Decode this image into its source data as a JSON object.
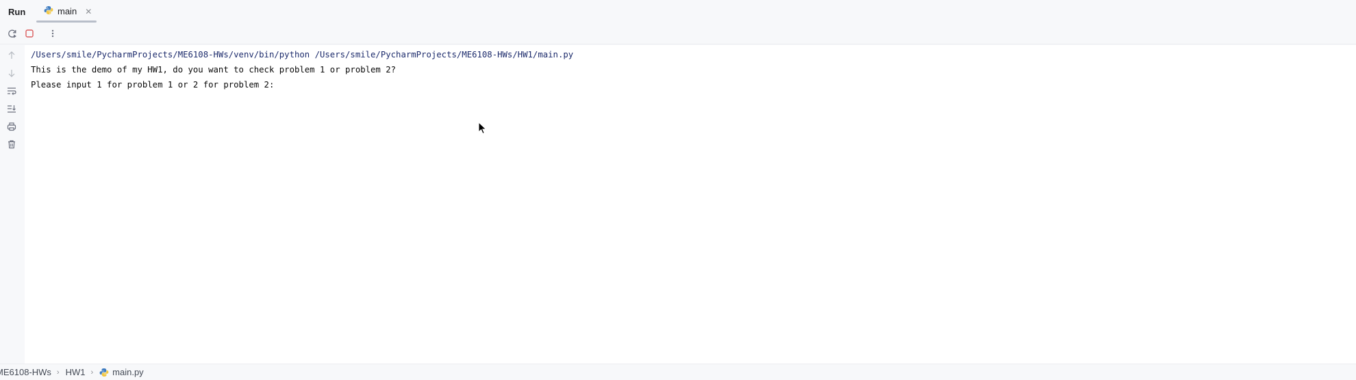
{
  "window": {
    "panel_title": "Run",
    "tabs": [
      {
        "label": "main",
        "icon": "python-file-icon",
        "active": true
      }
    ]
  },
  "toolbar": {
    "buttons": [
      "rerun-icon",
      "stop-icon",
      "more-options-icon"
    ]
  },
  "side_tools": [
    "up-arrow-icon",
    "down-arrow-icon",
    "soft-wrap-icon",
    "scroll-to-end-icon",
    "print-icon",
    "trash-icon"
  ],
  "console": {
    "lines": [
      "/Users/smile/PycharmProjects/ME6108-HWs/venv/bin/python /Users/smile/PycharmProjects/ME6108-HWs/HW1/main.py",
      "This is the demo of my HW1, do you want to check problem 1 or problem 2?",
      "Please input 1 for problem 1 or 2 for problem 2:"
    ]
  },
  "breadcrumb": {
    "items": [
      "ME6108-HWs",
      "HW1",
      "main.py"
    ]
  },
  "colors": {
    "background": "#f7f8fa",
    "console_bg": "#ffffff",
    "stop_red": "#db5c5c",
    "python_blue": "#3f7cc0",
    "python_yellow": "#f2c744"
  }
}
